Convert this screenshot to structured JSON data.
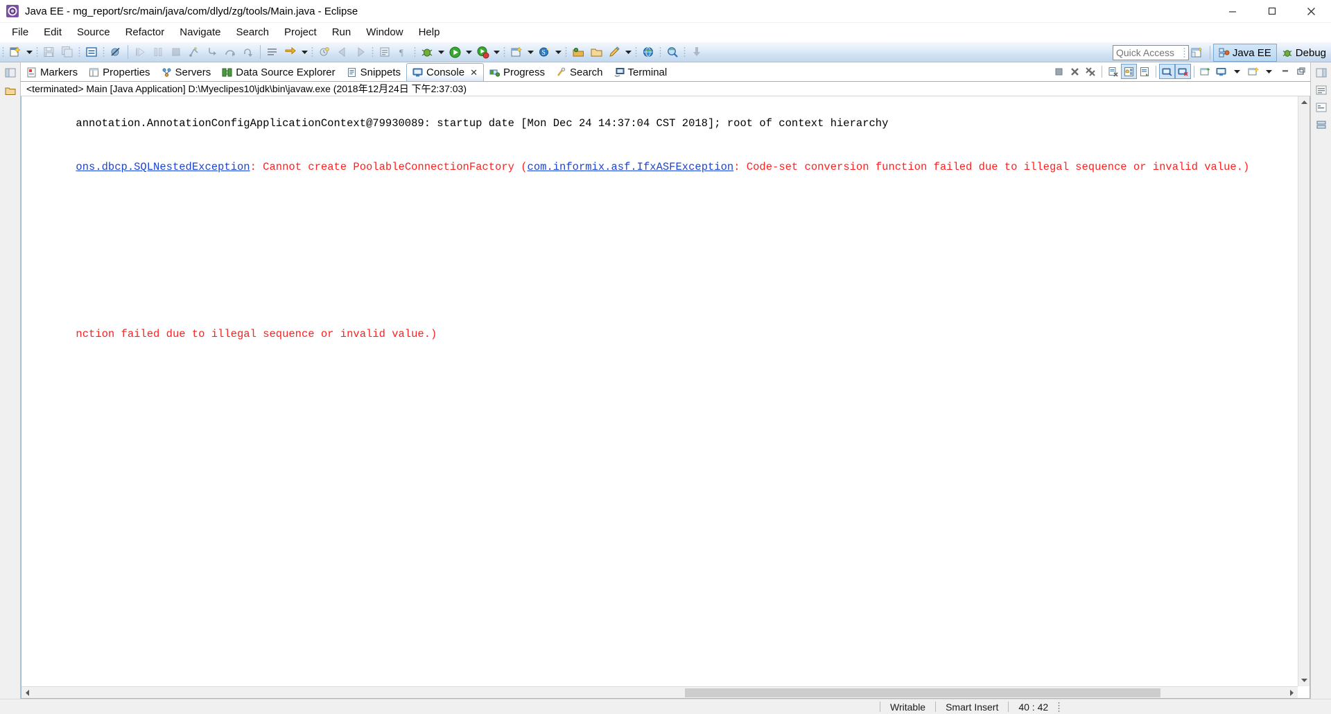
{
  "window": {
    "title": "Java EE - mg_report/src/main/java/com/dlyd/zg/tools/Main.java - Eclipse",
    "app_icon": "eclipse-icon",
    "minimize_label": "Minimize",
    "maximize_label": "Maximize",
    "close_label": "Close"
  },
  "menubar": {
    "items": [
      {
        "label": "File"
      },
      {
        "label": "Edit"
      },
      {
        "label": "Source"
      },
      {
        "label": "Refactor"
      },
      {
        "label": "Navigate"
      },
      {
        "label": "Search"
      },
      {
        "label": "Project"
      },
      {
        "label": "Run"
      },
      {
        "label": "Window"
      },
      {
        "label": "Help"
      }
    ]
  },
  "toolbar": {
    "quick_access_placeholder": "Quick Access",
    "quick_access_value": "",
    "open_perspective_label": "Open Perspective",
    "perspectives": [
      {
        "label": "Java EE",
        "icon": "java-ee-perspective-icon",
        "active": true
      },
      {
        "label": "Debug",
        "icon": "debug-perspective-icon",
        "active": false
      }
    ],
    "buttons": [
      {
        "name": "new-wizard-button",
        "icon": "new-file-icon"
      },
      {
        "name": "new-wizard-dropdown",
        "icon": "chevron-down-icon"
      },
      {
        "name": "save-button",
        "icon": "save-icon"
      },
      {
        "name": "save-all-button",
        "icon": "save-all-icon"
      },
      {
        "name": "open-type-button",
        "icon": "open-type-icon"
      },
      {
        "name": "toggle-breakpoint-button",
        "icon": "skip-breakpoints-icon"
      },
      {
        "name": "resume-button",
        "icon": "resume-icon"
      },
      {
        "name": "suspend-button",
        "icon": "suspend-icon"
      },
      {
        "name": "terminate-button",
        "icon": "terminate-icon"
      },
      {
        "name": "disconnect-button",
        "icon": "disconnect-icon"
      },
      {
        "name": "step-into-button",
        "icon": "step-into-icon"
      },
      {
        "name": "step-over-button",
        "icon": "step-over-icon"
      },
      {
        "name": "step-return-button",
        "icon": "step-return-icon"
      },
      {
        "name": "toggle-markoccurrences-button",
        "icon": "mark-occurrences-icon"
      },
      {
        "name": "next-annotation-button",
        "icon": "next-annotation-icon"
      },
      {
        "name": "previous-annotation-button",
        "icon": "previous-annotation-icon"
      },
      {
        "name": "last-edit-location-button",
        "icon": "last-edit-location-icon"
      },
      {
        "name": "back-button",
        "icon": "back-arrow-icon"
      },
      {
        "name": "forward-button",
        "icon": "forward-arrow-icon"
      }
    ]
  },
  "views": {
    "tabs": [
      {
        "label": "Markers",
        "icon": "markers-icon",
        "active": false
      },
      {
        "label": "Properties",
        "icon": "properties-icon",
        "active": false
      },
      {
        "label": "Servers",
        "icon": "servers-icon",
        "active": false
      },
      {
        "label": "Data Source Explorer",
        "icon": "data-source-explorer-icon",
        "active": false
      },
      {
        "label": "Snippets",
        "icon": "snippets-icon",
        "active": false
      },
      {
        "label": "Console",
        "icon": "console-icon",
        "active": true,
        "closeable": true
      },
      {
        "label": "Progress",
        "icon": "progress-icon",
        "active": false
      },
      {
        "label": "Search",
        "icon": "search-icon",
        "active": false
      },
      {
        "label": "Terminal",
        "icon": "terminal-icon",
        "active": false
      }
    ],
    "console_toolbar": [
      {
        "name": "terminate-console-button",
        "icon": "terminate-icon",
        "toggled": false
      },
      {
        "name": "remove-launch-button",
        "icon": "remove-icon",
        "toggled": false
      },
      {
        "name": "remove-all-terminated-button",
        "icon": "remove-all-icon",
        "toggled": false
      },
      {
        "name": "clear-console-button",
        "icon": "clear-console-icon",
        "toggled": false
      },
      {
        "name": "scroll-lock-button",
        "icon": "scroll-lock-icon",
        "toggled": true
      },
      {
        "name": "word-wrap-button",
        "icon": "word-wrap-icon",
        "toggled": false
      },
      {
        "name": "show-console-on-output-button",
        "icon": "show-console-output-icon",
        "toggled": true
      },
      {
        "name": "show-console-on-error-button",
        "icon": "show-console-error-icon",
        "toggled": true
      },
      {
        "name": "pin-console-button",
        "icon": "pin-console-icon",
        "toggled": false
      },
      {
        "name": "display-selected-console-button",
        "icon": "display-console-icon",
        "toggled": false
      },
      {
        "name": "display-selected-console-dropdown",
        "icon": "chevron-down-icon",
        "toggled": false
      },
      {
        "name": "open-console-button",
        "icon": "open-console-icon",
        "toggled": false
      },
      {
        "name": "open-console-dropdown",
        "icon": "chevron-down-icon",
        "toggled": false
      },
      {
        "name": "minimize-view-button",
        "icon": "minimize-icon",
        "toggled": false
      },
      {
        "name": "maximize-view-button",
        "icon": "maximize-icon",
        "toggled": false
      }
    ]
  },
  "console": {
    "launch_header": "<terminated> Main [Java Application] D:\\Myeclipes10\\jdk\\bin\\javaw.exe (2018年12月24日 下午2:37:03)",
    "colors": {
      "stdout": "#000000",
      "stderr": "#ff2020",
      "hyperlink": "#1a44d6"
    },
    "lines": [
      {
        "name": "console-line-startup",
        "segments": [
          {
            "text": "annotation.AnnotationConfigApplicationContext@79930089: startup date [Mon Dec 24 14:37:04 CST 2018]; root of context hierarchy",
            "style": "stdout"
          }
        ]
      },
      {
        "name": "console-line-exception",
        "segments": [
          {
            "text": "ons.dbcp.SQLNestedException",
            "style": "hyperlink"
          },
          {
            "text": ": Cannot create PoolableConnectionFactory (",
            "style": "stderr"
          },
          {
            "text": "com.informix.asf.IfxASFException",
            "style": "hyperlink"
          },
          {
            "text": ": Code-set conversion function failed due to illegal sequence or invalid value.)",
            "style": "stderr"
          }
        ]
      },
      {
        "name": "console-line-wrapped-tail",
        "segments": [
          {
            "text": "nction failed due to illegal sequence or invalid value.)",
            "style": "stderr"
          }
        ]
      }
    ],
    "scroll": {
      "horizontal_thumb_position_percent": 52,
      "horizontal_thumb_width_percent": 38
    }
  },
  "statusbar": {
    "writable": "Writable",
    "insert_mode": "Smart Insert",
    "cursor_position": "40 : 42"
  }
}
